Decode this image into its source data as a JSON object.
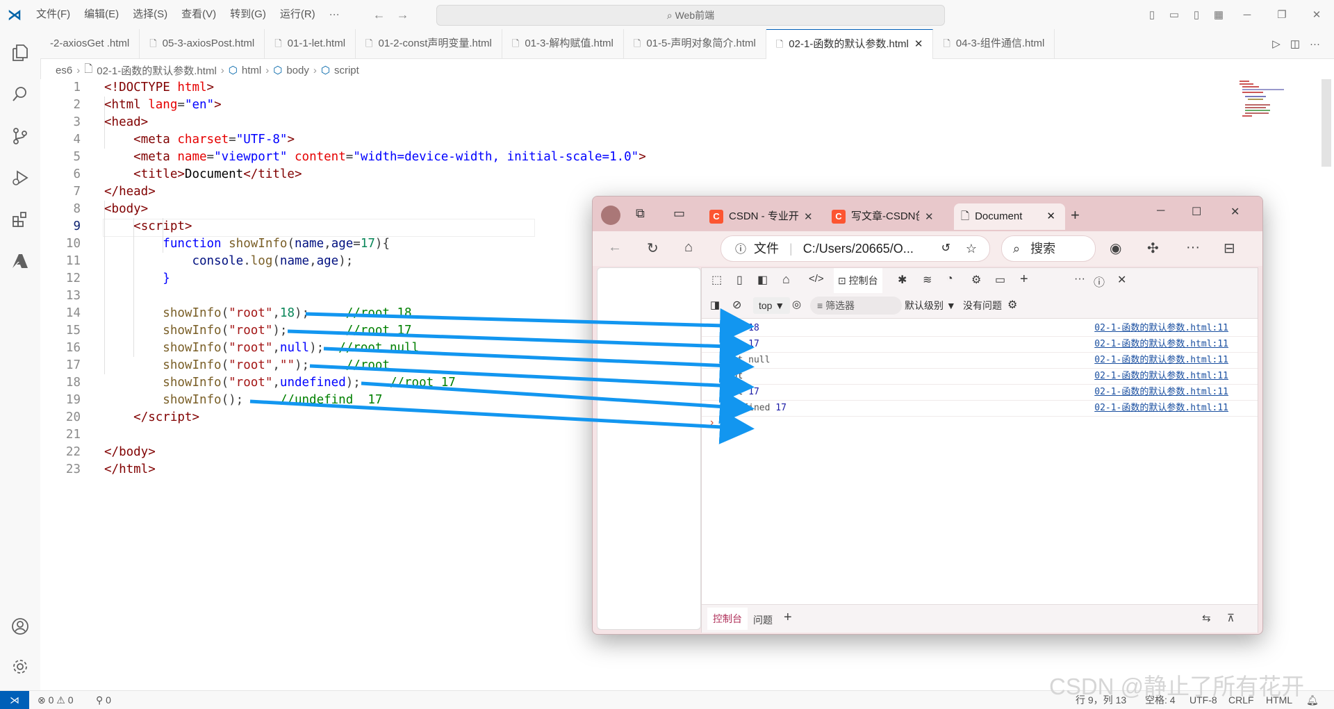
{
  "titlebar": {
    "menus": [
      "文件(F)",
      "编辑(E)",
      "选择(S)",
      "查看(V)",
      "转到(G)",
      "运行(R)",
      "···"
    ],
    "command_center": "Web前端"
  },
  "tabs": [
    {
      "label": "-2-axiosGet .html",
      "active": false
    },
    {
      "label": "05-3-axiosPost.html",
      "active": false
    },
    {
      "label": "01-1-let.html",
      "active": false
    },
    {
      "label": "01-2-const声明变量.html",
      "active": false
    },
    {
      "label": "01-3-解构赋值.html",
      "active": false
    },
    {
      "label": "01-5-声明对象简介.html",
      "active": false
    },
    {
      "label": "02-1-函数的默认参数.html",
      "active": true
    },
    {
      "label": "04-3-组件通信.html",
      "active": false
    }
  ],
  "breadcrumb": [
    "es6",
    "02-1-函数的默认参数.html",
    "html",
    "body",
    "script"
  ],
  "editor": {
    "line_numbers": [
      "1",
      "2",
      "3",
      "4",
      "5",
      "6",
      "7",
      "8",
      "9",
      "10",
      "11",
      "12",
      "13",
      "14",
      "15",
      "16",
      "17",
      "18",
      "19",
      "20",
      "21",
      "22",
      "23"
    ],
    "current_line": 9
  },
  "browser": {
    "tabs": [
      "CSDN - 专业开",
      "写文章-CSDN创",
      "Document"
    ],
    "address_label": "文件",
    "address": "C:/Users/20665/O...",
    "search_label": "搜索",
    "devtools": {
      "panel_active": "控制台",
      "context": "top",
      "filter_placeholder": "筛选器",
      "level": "默认级别",
      "issues": "没有问题",
      "bottom_tabs": [
        "控制台",
        "问题"
      ],
      "logs": [
        {
          "text": "root",
          "value": "18",
          "source": "02-1-函数的默认参数.html:11"
        },
        {
          "text": "root",
          "value": "17",
          "source": "02-1-函数的默认参数.html:11"
        },
        {
          "text": "root null",
          "value": "",
          "source": "02-1-函数的默认参数.html:11"
        },
        {
          "text": "root",
          "value": "",
          "source": "02-1-函数的默认参数.html:11"
        },
        {
          "text": "root",
          "value": "17",
          "source": "02-1-函数的默认参数.html:11"
        },
        {
          "text": "undefined",
          "value": "17",
          "source": "02-1-函数的默认参数.html:11"
        }
      ]
    }
  },
  "statusbar": {
    "problems": "⊗ 0 ⚠ 0",
    "ports": "⚲ 0",
    "position": "行 9，列 13",
    "spaces": "空格: 4",
    "encoding": "UTF-8",
    "eol": "CRLF",
    "language": "HTML"
  },
  "watermark": "CSDN @静止了所有花开",
  "colors": {
    "accent": "#005fb8",
    "arrow": "#1296f0",
    "browser_frame": "#e8c8cb"
  }
}
